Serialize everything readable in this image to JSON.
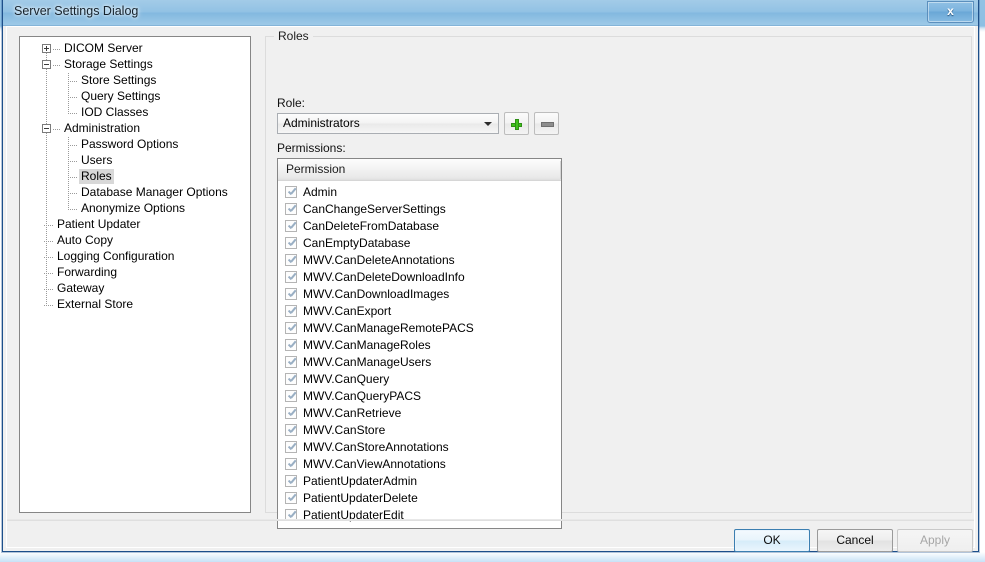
{
  "window": {
    "title": "Server Settings Dialog",
    "close_icon": "close-icon",
    "close_label": "x"
  },
  "tree": {
    "nodes": [
      {
        "label": "DICOM Server",
        "level": 0,
        "expander": "plus",
        "selected": false
      },
      {
        "label": "Storage Settings",
        "level": 0,
        "expander": "minus",
        "selected": false
      },
      {
        "label": "Store Settings",
        "level": 1,
        "expander": "none",
        "selected": false
      },
      {
        "label": "Query Settings",
        "level": 1,
        "expander": "none",
        "selected": false
      },
      {
        "label": "IOD Classes",
        "level": 1,
        "expander": "none",
        "selected": false
      },
      {
        "label": "Administration",
        "level": 0,
        "expander": "minus",
        "selected": false
      },
      {
        "label": "Password Options",
        "level": 1,
        "expander": "none",
        "selected": false
      },
      {
        "label": "Users",
        "level": 1,
        "expander": "none",
        "selected": false
      },
      {
        "label": "Roles",
        "level": 1,
        "expander": "none",
        "selected": true
      },
      {
        "label": "Database Manager Options",
        "level": 1,
        "expander": "none",
        "selected": false
      },
      {
        "label": "Anonymize Options",
        "level": 1,
        "expander": "none",
        "selected": false
      },
      {
        "label": "Patient Updater",
        "level": 0,
        "expander": "none",
        "selected": false
      },
      {
        "label": "Auto Copy",
        "level": 0,
        "expander": "none",
        "selected": false
      },
      {
        "label": "Logging Configuration",
        "level": 0,
        "expander": "none",
        "selected": false
      },
      {
        "label": "Forwarding",
        "level": 0,
        "expander": "none",
        "selected": false
      },
      {
        "label": "Gateway",
        "level": 0,
        "expander": "none",
        "selected": false
      },
      {
        "label": "External Store",
        "level": 0,
        "expander": "none",
        "selected": false
      }
    ]
  },
  "roles_group": {
    "title": "Roles",
    "role_label": "Role:",
    "role_selected": "Administrators",
    "add_button_icon": "plus-icon",
    "remove_button_icon": "minus-icon",
    "permissions_label": "Permissions:",
    "permissions_column_header": "Permission",
    "permissions": [
      {
        "label": "Admin",
        "checked": true
      },
      {
        "label": "CanChangeServerSettings",
        "checked": true
      },
      {
        "label": "CanDeleteFromDatabase",
        "checked": true
      },
      {
        "label": "CanEmptyDatabase",
        "checked": true
      },
      {
        "label": "MWV.CanDeleteAnnotations",
        "checked": true
      },
      {
        "label": "MWV.CanDeleteDownloadInfo",
        "checked": true
      },
      {
        "label": "MWV.CanDownloadImages",
        "checked": true
      },
      {
        "label": "MWV.CanExport",
        "checked": true
      },
      {
        "label": "MWV.CanManageRemotePACS",
        "checked": true
      },
      {
        "label": "MWV.CanManageRoles",
        "checked": true
      },
      {
        "label": "MWV.CanManageUsers",
        "checked": true
      },
      {
        "label": "MWV.CanQuery",
        "checked": true
      },
      {
        "label": "MWV.CanQueryPACS",
        "checked": true
      },
      {
        "label": "MWV.CanRetrieve",
        "checked": true
      },
      {
        "label": "MWV.CanStore",
        "checked": true
      },
      {
        "label": "MWV.CanStoreAnnotations",
        "checked": true
      },
      {
        "label": "MWV.CanViewAnnotations",
        "checked": true
      },
      {
        "label": "PatientUpdaterAdmin",
        "checked": true
      },
      {
        "label": "PatientUpdaterDelete",
        "checked": true
      },
      {
        "label": "PatientUpdaterEdit",
        "checked": true
      }
    ]
  },
  "footer": {
    "ok_label": "OK",
    "cancel_label": "Cancel",
    "apply_label": "Apply"
  },
  "colors": {
    "accent_blue": "#3c7fb1",
    "title_blue": "#7cb4de",
    "plus_green": "#3fc21c",
    "check_gray_blue": "#9aafc4",
    "dialog_face": "#f0f0f0"
  }
}
